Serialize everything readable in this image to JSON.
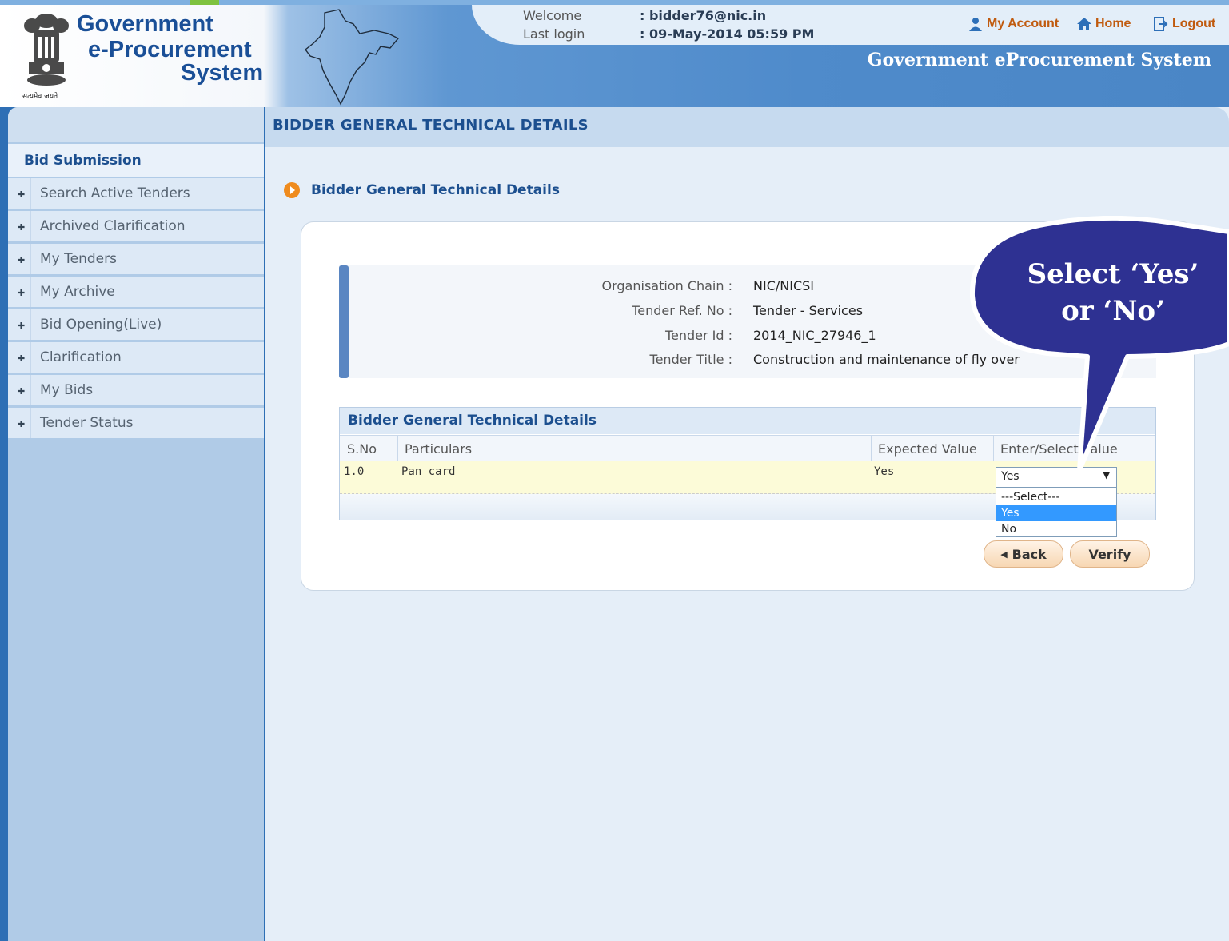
{
  "header": {
    "logo_line1": "Government",
    "logo_line2": "e-Procurement",
    "logo_line3": "System",
    "motto": "सत्यमेव जयते",
    "welcome_label": "Welcome",
    "welcome_value": ": bidder76@nic.in",
    "last_login_label": "Last login",
    "last_login_value": ": 09-May-2014 05:59 PM",
    "links": {
      "my_account": "My Account",
      "home": "Home",
      "logout": "Logout"
    },
    "system_name": "Government eProcurement System"
  },
  "sidebar": {
    "heading": "Bid Submission",
    "items": [
      {
        "label": "Search Active Tenders"
      },
      {
        "label": "Archived Clarification"
      },
      {
        "label": "My Tenders"
      },
      {
        "label": "My Archive"
      },
      {
        "label": "Bid Opening(Live)"
      },
      {
        "label": "Clarification"
      },
      {
        "label": "My Bids"
      },
      {
        "label": "Tender Status"
      }
    ]
  },
  "main": {
    "page_title": "BIDDER GENERAL TECHNICAL DETAILS",
    "section_title": "Bidder General Technical Details",
    "info": {
      "org_label": "Organisation Chain :",
      "org_value": "NIC/NICSI",
      "ref_label": "Tender Ref. No :",
      "ref_value": "Tender - Services",
      "id_label": "Tender Id :",
      "id_value": "2014_NIC_27946_1",
      "title_label": "Tender Title :",
      "title_value": "Construction and maintenance of fly over"
    },
    "table": {
      "caption": "Bidder General Technical Details",
      "columns": [
        "S.No",
        "Particulars",
        "Expected Value",
        "Enter/Select Value"
      ],
      "rows": [
        {
          "sno": "1.0",
          "particulars": "Pan card",
          "expected": "Yes",
          "selected": "Yes"
        }
      ],
      "dropdown_options": [
        "---Select---",
        "Yes",
        "No"
      ],
      "highlighted_option": "Yes"
    },
    "buttons": {
      "back": "Back",
      "verify": "Verify"
    }
  },
  "callout": {
    "line1": "Select ‘Yes’",
    "line2": "or ‘No’"
  },
  "colors": {
    "brand_blue": "#1c4f8f",
    "accent_orange": "#ef8b1e",
    "callout_fill": "#2e3192",
    "highlight_blue": "#3399ff"
  }
}
